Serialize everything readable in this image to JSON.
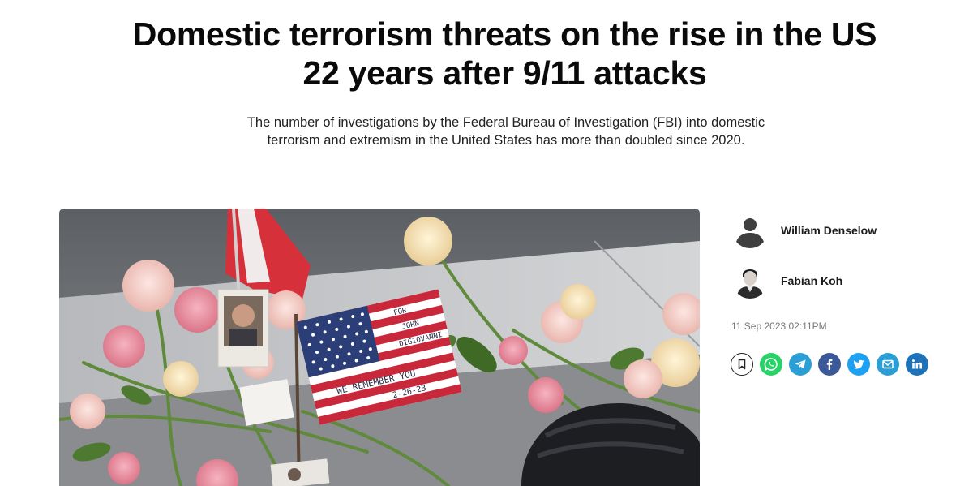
{
  "article": {
    "headline_line1": "Domestic terrorism threats on the rise in the US",
    "headline_line2": "22 years after 9/11 attacks",
    "standfirst_line1": "The number of investigations by the Federal Bureau of Investigation (FBI) into domestic",
    "standfirst_line2": "terrorism and extremism in the United States has more than doubled since 2020."
  },
  "hero_image": {
    "flag_text": [
      "FOR",
      "JOHN",
      "DIGIOVANNI",
      "WE REMEMBER YOU",
      "2-26-23"
    ]
  },
  "authors": [
    {
      "name": "William Denselow",
      "avatar": "silhouette-avatar"
    },
    {
      "name": "Fabian Koh",
      "avatar": "photo-avatar"
    }
  ],
  "published": "11 Sep 2023 02:11PM",
  "share": [
    {
      "name": "bookmark",
      "color": "#ffffff",
      "icon": "bookmark-icon"
    },
    {
      "name": "whatsapp",
      "color": "#25d366",
      "icon": "whatsapp-icon"
    },
    {
      "name": "telegram",
      "color": "#2a9fd6",
      "icon": "telegram-icon"
    },
    {
      "name": "facebook",
      "color": "#3b5998",
      "icon": "facebook-icon"
    },
    {
      "name": "twitter",
      "color": "#1da1f2",
      "icon": "twitter-icon"
    },
    {
      "name": "email",
      "color": "#2a9fd6",
      "icon": "email-icon"
    },
    {
      "name": "linkedin",
      "color": "#1e72b9",
      "icon": "linkedin-icon"
    }
  ]
}
